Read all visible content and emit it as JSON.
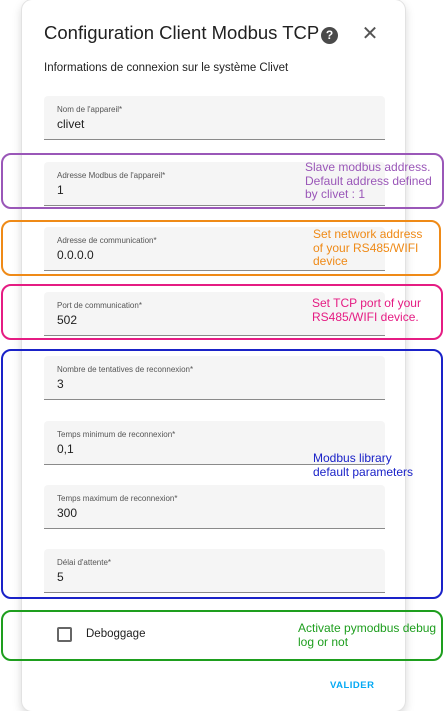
{
  "dialog": {
    "title": "Configuration Client Modbus TCP",
    "help_icon": "?",
    "close_icon": "✕",
    "subtitle": "Informations de connexion sur le système Clivet",
    "fields": [
      {
        "label": "Nom de l'appareil*",
        "value": "clivet"
      },
      {
        "label": "Adresse Modbus de l'appareil*",
        "value": "1"
      },
      {
        "label": "Adresse de communication*",
        "value": "0.0.0.0"
      },
      {
        "label": "Port de communication*",
        "value": "502"
      },
      {
        "label": "Nombre de tentatives de reconnexion*",
        "value": "3"
      },
      {
        "label": "Temps minimum de reconnexion*",
        "value": "0,1"
      },
      {
        "label": "Temps maximum de reconnexion*",
        "value": "300"
      },
      {
        "label": "Délai d'attente*",
        "value": "5"
      }
    ],
    "checkbox": {
      "label": "Deboggage",
      "checked": false
    },
    "submit_label": "VALIDER"
  },
  "annotations": [
    {
      "text": "Slave modbus address. Default address defined by clivet : 1",
      "color": "#9a57b8"
    },
    {
      "text": "Set network address of your RS485/WIFI device",
      "color": "#ef8a17"
    },
    {
      "text": "Set TCP port of your RS485/WIFI device.",
      "color": "#e51c83"
    },
    {
      "text": "Modbus library default parameters",
      "color": "#1a22c8"
    },
    {
      "text": "Activate pymodbus debug log or not",
      "color": "#1e9e1e"
    }
  ]
}
